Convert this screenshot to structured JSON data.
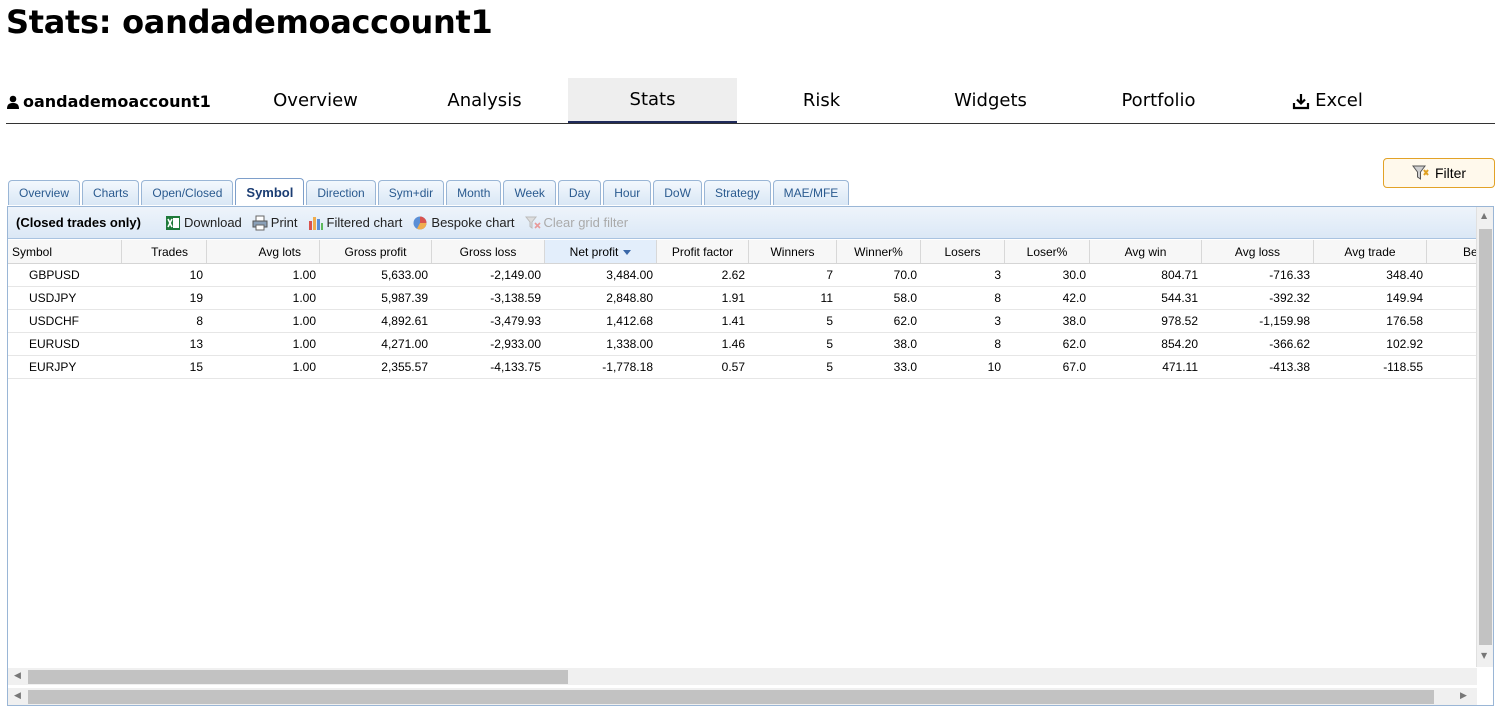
{
  "page": {
    "title": "Stats: oandademoaccount1"
  },
  "account": {
    "name": "oandademoaccount1"
  },
  "topnav": {
    "tabs": [
      {
        "label": "Overview"
      },
      {
        "label": "Analysis"
      },
      {
        "label": "Stats"
      },
      {
        "label": "Risk"
      },
      {
        "label": "Widgets"
      },
      {
        "label": "Portfolio"
      },
      {
        "label": "Excel"
      }
    ],
    "active": "Stats"
  },
  "filter": {
    "label": "Filter"
  },
  "subtabs": {
    "items": [
      "Overview",
      "Charts",
      "Open/Closed",
      "Symbol",
      "Direction",
      "Sym+dir",
      "Month",
      "Week",
      "Day",
      "Hour",
      "DoW",
      "Strategy",
      "MAE/MFE"
    ],
    "active": "Symbol"
  },
  "toolbar": {
    "note": "(Closed trades only)",
    "download": "Download",
    "print": "Print",
    "filtered_chart": "Filtered chart",
    "bespoke_chart": "Bespoke chart",
    "clear_filter": "Clear grid filter"
  },
  "table": {
    "columns": [
      "Symbol",
      "Trades",
      "Avg lots",
      "Gross profit",
      "Gross loss",
      "Net profit",
      "Profit factor",
      "Winners",
      "Winner%",
      "Losers",
      "Loser%",
      "Avg win",
      "Avg loss",
      "Avg trade",
      "Be"
    ],
    "sorted_column": "Net profit",
    "rows": [
      [
        "GBPUSD",
        "10",
        "1.00",
        "5,633.00",
        "-2,149.00",
        "3,484.00",
        "2.62",
        "7",
        "70.0",
        "3",
        "30.0",
        "804.71",
        "-716.33",
        "348.40"
      ],
      [
        "USDJPY",
        "19",
        "1.00",
        "5,987.39",
        "-3,138.59",
        "2,848.80",
        "1.91",
        "11",
        "58.0",
        "8",
        "42.0",
        "544.31",
        "-392.32",
        "149.94"
      ],
      [
        "USDCHF",
        "8",
        "1.00",
        "4,892.61",
        "-3,479.93",
        "1,412.68",
        "1.41",
        "5",
        "62.0",
        "3",
        "38.0",
        "978.52",
        "-1,159.98",
        "176.58"
      ],
      [
        "EURUSD",
        "13",
        "1.00",
        "4,271.00",
        "-2,933.00",
        "1,338.00",
        "1.46",
        "5",
        "38.0",
        "8",
        "62.0",
        "854.20",
        "-366.62",
        "102.92"
      ],
      [
        "EURJPY",
        "15",
        "1.00",
        "2,355.57",
        "-4,133.75",
        "-1,778.18",
        "0.57",
        "5",
        "33.0",
        "10",
        "67.0",
        "471.11",
        "-413.38",
        "-118.55"
      ]
    ]
  }
}
